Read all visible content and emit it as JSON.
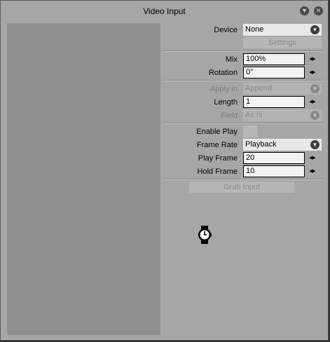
{
  "window": {
    "title": "Video Input"
  },
  "controls": {
    "device": {
      "label": "Device",
      "value": "None"
    },
    "settings_button": "Settings",
    "mix": {
      "label": "Mix",
      "value": "100%"
    },
    "rotation": {
      "label": "Rotation",
      "value": "0°"
    },
    "apply_in": {
      "label": "Apply in",
      "value": "Append"
    },
    "length": {
      "label": "Length",
      "value": "1"
    },
    "field": {
      "label": "Field",
      "value": "As Is"
    },
    "enable_play": {
      "label": "Enable Play"
    },
    "frame_rate": {
      "label": "Frame Rate",
      "value": "Playback"
    },
    "play_frame": {
      "label": "Play Frame",
      "value": "20"
    },
    "hold_frame": {
      "label": "Hold Frame",
      "value": "10"
    },
    "grab_input_button": "Grab Input"
  },
  "icons": {
    "collapse": "chevron-down-icon",
    "close": "close-icon",
    "dropdown": "chevron-down-icon",
    "spinner": "left-right-arrows-icon",
    "busy": "watch-icon"
  }
}
